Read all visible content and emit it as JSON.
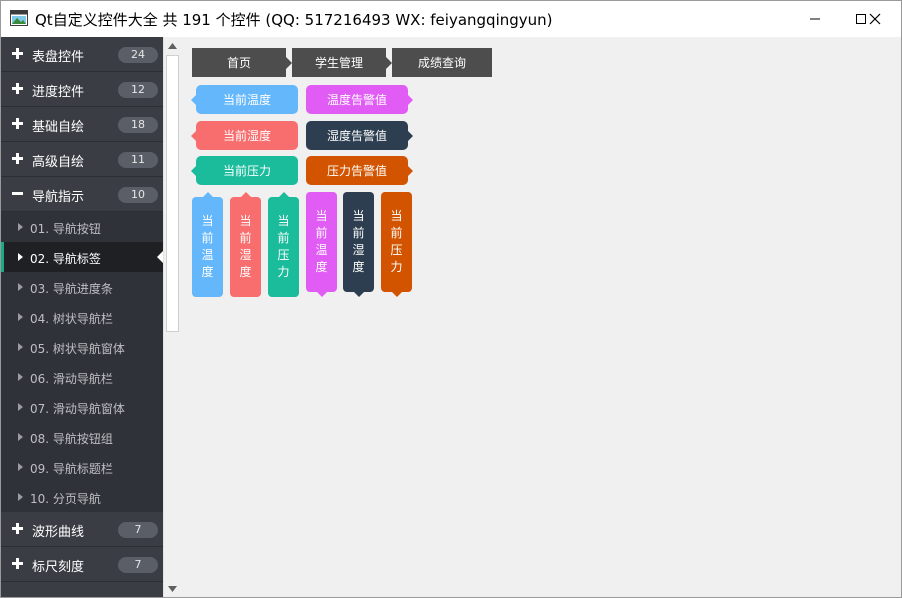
{
  "window": {
    "title": "Qt自定义控件大全 共 191 个控件 (QQ: 517216493 WX: feiyangqingyun)",
    "icons": [
      "app-icon",
      "minimize-icon",
      "maximize-icon",
      "close-icon"
    ]
  },
  "sidebar": {
    "groups_top": [
      {
        "label": "表盘控件",
        "count": "24"
      },
      {
        "label": "进度控件",
        "count": "12"
      },
      {
        "label": "基础自绘",
        "count": "18"
      },
      {
        "label": "高级自绘",
        "count": "11"
      },
      {
        "label": "导航指示",
        "count": "10"
      }
    ],
    "items": [
      {
        "label": "01. 导航按钮"
      },
      {
        "label": "02. 导航标签"
      },
      {
        "label": "03. 导航进度条"
      },
      {
        "label": "04. 树状导航栏"
      },
      {
        "label": "05. 树状导航窗体"
      },
      {
        "label": "06. 滑动导航栏"
      },
      {
        "label": "07. 滑动导航窗体"
      },
      {
        "label": "08. 导航按钮组"
      },
      {
        "label": "09. 导航标题栏"
      },
      {
        "label": "10. 分页导航"
      }
    ],
    "selected_item": "02. 导航标签",
    "groups_bottom": [
      {
        "label": "波形曲线",
        "count": "7"
      },
      {
        "label": "标尺刻度",
        "count": "7"
      }
    ],
    "accent_color": "#1aaa87"
  },
  "breadcrumb": {
    "items": [
      "首页",
      "学生管理",
      "成绩查询"
    ],
    "color": "#4d4d4d"
  },
  "tags_horizontal": [
    {
      "text": "当前温度",
      "color": "#64b7fb",
      "arrow": "left"
    },
    {
      "text": "温度告警值",
      "color": "#e05cf5",
      "arrow": "right"
    },
    {
      "text": "当前湿度",
      "color": "#f86d6d",
      "arrow": "left"
    },
    {
      "text": "湿度告警值",
      "color": "#2c3e50",
      "arrow": "right"
    },
    {
      "text": "当前压力",
      "color": "#1abc9c",
      "arrow": "left"
    },
    {
      "text": "压力告警值",
      "color": "#d35400",
      "arrow": "right"
    }
  ],
  "tags_vertical": [
    {
      "text": [
        "当",
        "前",
        "温",
        "度"
      ],
      "color": "#64b7fb",
      "arrow": "top"
    },
    {
      "text": [
        "当",
        "前",
        "湿",
        "度"
      ],
      "color": "#f86d6d",
      "arrow": "top"
    },
    {
      "text": [
        "当",
        "前",
        "压",
        "力"
      ],
      "color": "#1abc9c",
      "arrow": "top"
    },
    {
      "text": [
        "当",
        "前",
        "温",
        "度"
      ],
      "color": "#e05cf5",
      "arrow": "bottom"
    },
    {
      "text": [
        "当",
        "前",
        "湿",
        "度"
      ],
      "color": "#2c3e50",
      "arrow": "bottom"
    },
    {
      "text": [
        "当",
        "前",
        "压",
        "力"
      ],
      "color": "#d35400",
      "arrow": "bottom"
    }
  ]
}
